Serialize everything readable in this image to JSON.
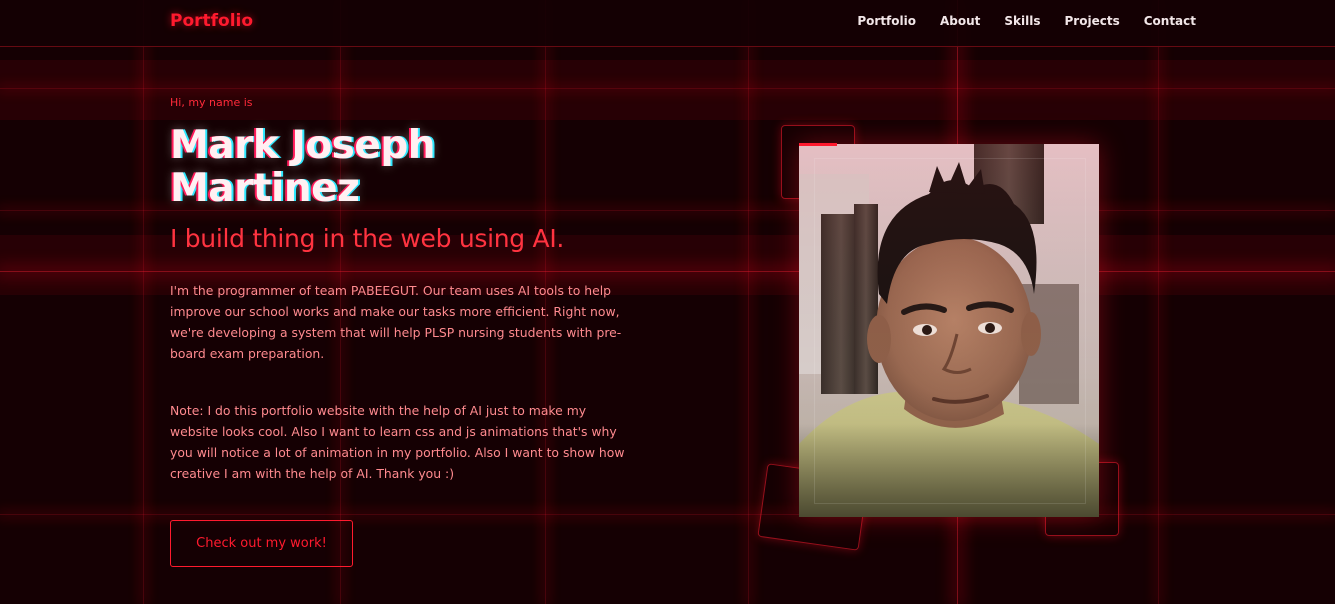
{
  "header": {
    "brand": "Portfolio",
    "nav": [
      "Portfolio",
      "About",
      "Skills",
      "Projects",
      "Contact"
    ]
  },
  "hero": {
    "greeting": "Hi, my name is",
    "name_line1": "Mark Joseph",
    "name_line2": "Martinez",
    "tagline": "I build thing in the web using AI.",
    "paragraph1": "I'm the programmer of team PABEEGUT. Our team uses AI tools to help improve our school works and make our tasks more efficient. Right now, we're developing a system that will help PLSP nursing students with pre-board exam preparation.",
    "paragraph2": "Note: I do this portfolio website with the help of AI just to make my website looks cool. Also I want to learn css and js animations that's why you will notice a lot of animation in my portfolio. Also I want to show how creative I am with the help of AI. Thank you :)",
    "cta_label": "Check out my work!"
  },
  "colors": {
    "background": "#150003",
    "accent": "#ff1a2e",
    "text_body": "#ff8a8f",
    "nav_text": "#f2e6e8"
  }
}
